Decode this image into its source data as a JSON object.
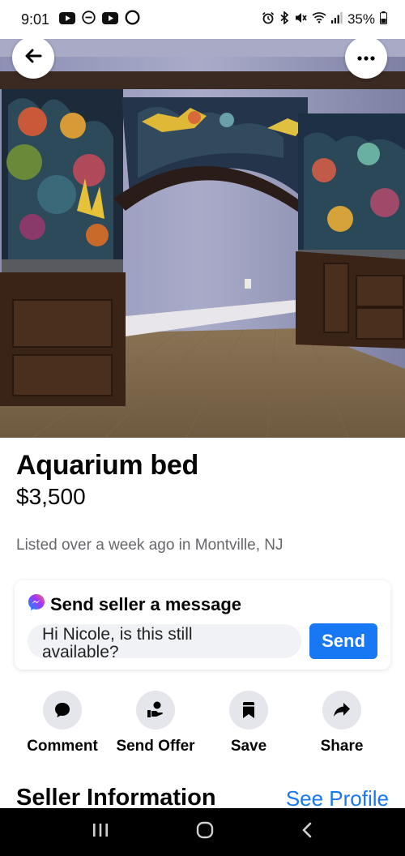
{
  "status_bar": {
    "time": "9:01",
    "battery": "35%",
    "left_icons": [
      "youtube-icon",
      "do-not-disturb-icon",
      "youtube-icon",
      "circle-app-icon"
    ],
    "right_icons": [
      "alarm-icon",
      "bluetooth-icon",
      "mute-icon",
      "wifi-icon",
      "signal-icon",
      "battery-icon"
    ]
  },
  "header": {
    "back_icon": "arrow-left-icon",
    "more_icon": "more-dots-icon"
  },
  "listing": {
    "title": "Aquarium bed",
    "price": "$3,500",
    "listed": "Listed over a week ago in Montville, NJ"
  },
  "message": {
    "heading": "Send seller a message",
    "input_value": "Hi Nicole, is this still available?",
    "send_label": "Send"
  },
  "actions": [
    {
      "label": "Comment",
      "icon": "comment-icon"
    },
    {
      "label": "Send Offer",
      "icon": "offer-icon"
    },
    {
      "label": "Save",
      "icon": "bookmark-icon"
    },
    {
      "label": "Share",
      "icon": "share-icon"
    }
  ],
  "seller": {
    "heading": "Seller Information",
    "link": "See Profile"
  },
  "nav": [
    "recents-icon",
    "home-icon",
    "back-icon"
  ],
  "colors": {
    "accent": "#1877f2",
    "secondary_text": "#65676b",
    "icon_bg": "#e4e6eb"
  }
}
